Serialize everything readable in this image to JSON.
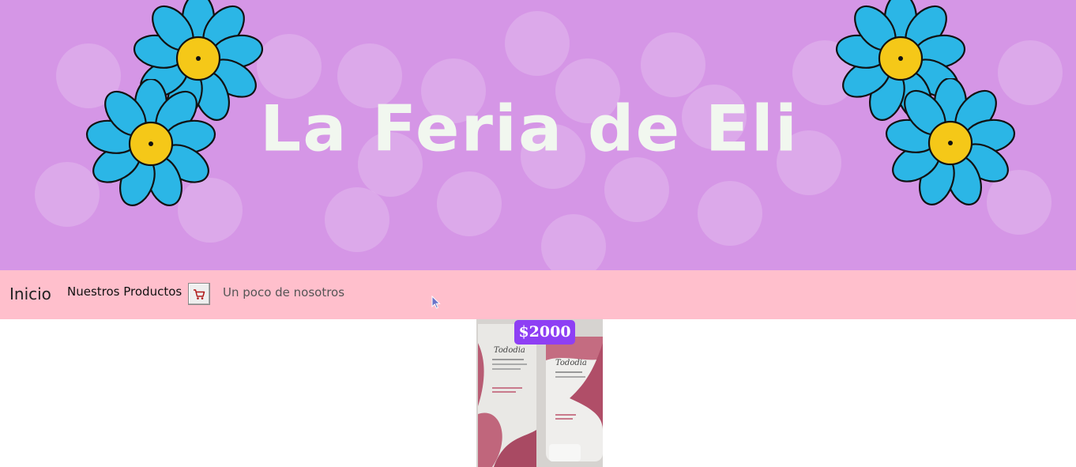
{
  "banner": {
    "title": "La Feria de Eli",
    "colors": {
      "background": "#d596e6",
      "title": "#f1f7ef",
      "petal": "#2bb6e6",
      "center": "#f5c818"
    }
  },
  "nav": {
    "home": "Inicio",
    "products": "Nuestros Productos",
    "cart_icon": "shopping-cart-icon",
    "about": "Un poco de nosotros",
    "background": "#ffbfcc"
  },
  "product": {
    "price": "$2000",
    "brand": "Tododia",
    "badge_color": "#8e3ff4"
  }
}
